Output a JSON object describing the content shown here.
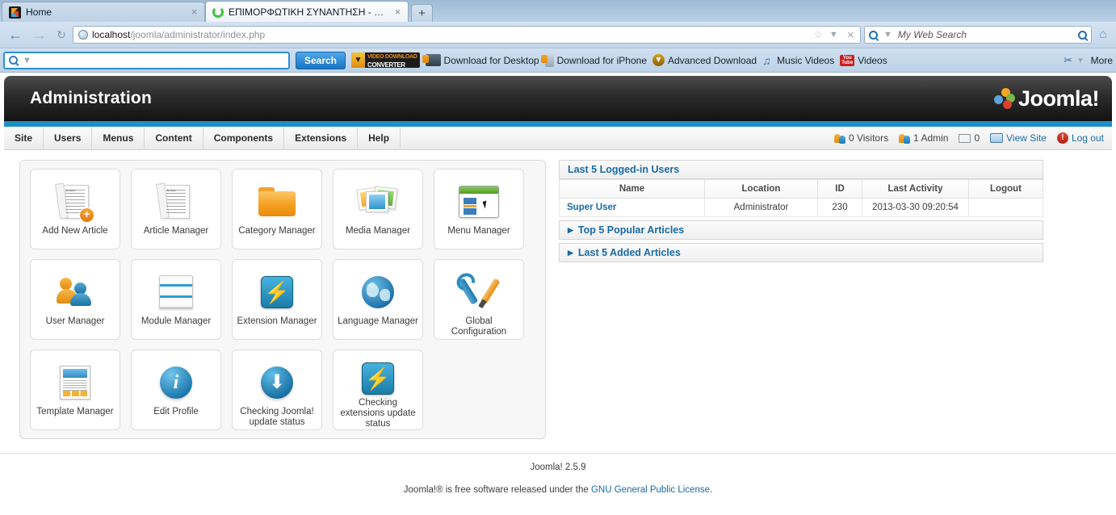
{
  "browser": {
    "tabs": [
      {
        "title": "Home",
        "icon": "joomla-favicon",
        "active": false,
        "close_label": "×"
      },
      {
        "title": "ΕΠΙΜΟΡΦΩΤΙΚΗ ΣΥΝΑΝΤΗΣΗ - Ad...",
        "icon": "loading-spinner-icon",
        "active": true,
        "close_label": "×"
      }
    ],
    "new_tab_label": "+",
    "nav": {
      "back_label": "←",
      "forward_label": "→",
      "reload_label": "↻",
      "home_label": "⌂"
    },
    "url": {
      "host": "localhost",
      "path": "/joomla/administrator/index.php",
      "star_label": "☆",
      "dropdown_label": "▼",
      "stop_label": "✕"
    },
    "search": {
      "placeholder": "My Web Search",
      "value": ""
    }
  },
  "addonbar": {
    "search_value": "",
    "search_button": "Search",
    "brand": {
      "line1": "VIDEO DOWNLOAD",
      "line2": "CONVERTER"
    },
    "items": [
      {
        "label": "Download for Desktop",
        "icon": "monitor-download-icon"
      },
      {
        "label": "Download for iPhone",
        "icon": "phone-download-icon"
      },
      {
        "label": "Advanced Download",
        "icon": "advanced-download-icon"
      },
      {
        "label": "Music Videos",
        "icon": "music-note-icon"
      },
      {
        "label": "Videos",
        "icon": "youtube-icon"
      }
    ],
    "more_label": "More",
    "tools_label": "▾"
  },
  "admin": {
    "header_title": "Administration",
    "logo_text": "Joomla!",
    "menu": [
      "Site",
      "Users",
      "Menus",
      "Content",
      "Components",
      "Extensions",
      "Help"
    ],
    "status": [
      {
        "icon": "visitors-icon",
        "label": "0 Visitors"
      },
      {
        "icon": "admin-icon",
        "label": "1 Admin"
      },
      {
        "icon": "messages-icon",
        "label": "0"
      },
      {
        "icon": "view-site-icon",
        "label": "View Site"
      },
      {
        "icon": "logout-icon",
        "label": "Log out"
      }
    ]
  },
  "quickicons": {
    "rows": [
      [
        {
          "label": "Add New Article",
          "icon": "new-article-icon"
        },
        {
          "label": "Article Manager",
          "icon": "article-manager-icon"
        },
        {
          "label": "Category Manager",
          "icon": "folder-icon"
        },
        {
          "label": "Media Manager",
          "icon": "media-images-icon"
        },
        {
          "label": "Menu Manager",
          "icon": "menu-window-icon"
        }
      ],
      [
        {
          "label": "User Manager",
          "icon": "users-icon"
        },
        {
          "label": "Module Manager",
          "icon": "module-stack-icon"
        },
        {
          "label": "Extension Manager",
          "icon": "bolt-icon"
        },
        {
          "label": "Language Manager",
          "icon": "globe-icon"
        },
        {
          "label": "Global Configuration",
          "icon": "wrench-screwdriver-icon"
        }
      ],
      [
        {
          "label": "Template Manager",
          "icon": "template-page-icon"
        },
        {
          "label": "Edit Profile",
          "icon": "info-icon"
        },
        {
          "label": "Checking Joomla! update status",
          "icon": "download-circle-icon"
        },
        {
          "label": "Checking extensions update status",
          "icon": "bolt-icon"
        }
      ]
    ]
  },
  "modules": {
    "logged_in": {
      "title": "Last 5 Logged-in Users",
      "columns": [
        "Name",
        "Location",
        "ID",
        "Last Activity",
        "Logout"
      ],
      "rows": [
        {
          "name": "Super User",
          "location": "Administrator",
          "id": "230",
          "last_activity": "2013-03-30 09:20:54",
          "logout": ""
        }
      ]
    },
    "popular": {
      "title": "Top 5 Popular Articles",
      "caret": "▶"
    },
    "latest": {
      "title": "Last 5 Added Articles",
      "caret": "▶"
    }
  },
  "footer": {
    "version": "Joomla! 2.5.9",
    "license_pre": "Joomla!® is free software released under the ",
    "license_link": "GNU General Public License",
    "license_post": "."
  },
  "colors": {
    "joomla_blue": "#1e90c8",
    "link_blue": "#176ba6",
    "orange": "#f0a32c",
    "header_dark": "#131313"
  }
}
